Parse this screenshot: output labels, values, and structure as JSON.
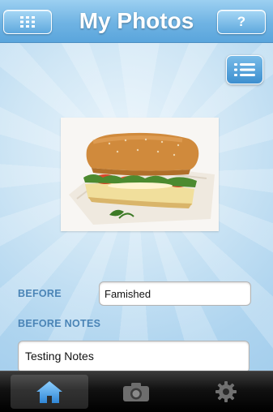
{
  "header": {
    "title": "My Photos",
    "help_label": "?"
  },
  "form": {
    "before_label": "BEFORE",
    "before_value": "Famished",
    "before_notes_label": "BEFORE NOTES",
    "before_notes_value": "Testing Notes"
  },
  "tabs": [
    {
      "name": "home",
      "icon": "home-icon",
      "selected": true
    },
    {
      "name": "camera",
      "icon": "camera-icon",
      "selected": false
    },
    {
      "name": "settings",
      "icon": "gear-icon",
      "selected": false
    }
  ],
  "colors": {
    "header": "#6fb3e3",
    "label": "#4a84b6",
    "tabbar": "#111111",
    "selected_tab_icon": "#5aa7e6"
  }
}
